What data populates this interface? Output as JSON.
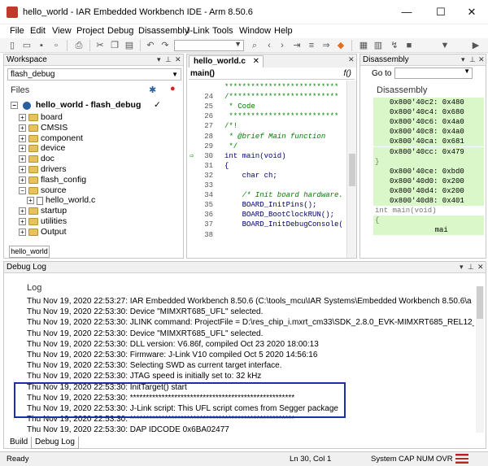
{
  "window": {
    "title": "hello_world - IAR Embedded Workbench IDE - Arm 8.50.6",
    "min_glyph": "—",
    "max_glyph": "☐",
    "close_glyph": "✕"
  },
  "menu": [
    "File",
    "Edit",
    "View",
    "Project",
    "Debug",
    "Disassembly",
    "J-Link",
    "Tools",
    "Window",
    "Help"
  ],
  "toolbar": {
    "icons": [
      "new-file-icon",
      "open-folder-icon",
      "save-icon",
      "save-all-icon",
      "print-icon",
      "cut-icon",
      "copy-icon",
      "paste-icon",
      "undo-icon",
      "redo-icon",
      "find-combo",
      "search-icon",
      "go-back-icon",
      "go-forward-icon",
      "next-statement-icon",
      "toggle-breakpoint-icon",
      "make-icon",
      "compile-icon",
      "build-icon",
      "stop-icon",
      "download-icon",
      "debug-icon"
    ],
    "find_value": ""
  },
  "workspace": {
    "panel_title": "Workspace",
    "config": "flash_debug",
    "files_label": "Files",
    "project": "hello_world - flash_debug",
    "project_check": "✓",
    "items": [
      {
        "label": "board",
        "type": "folder",
        "indent": 1
      },
      {
        "label": "CMSIS",
        "type": "folder",
        "indent": 1
      },
      {
        "label": "component",
        "type": "folder",
        "indent": 1
      },
      {
        "label": "device",
        "type": "folder",
        "indent": 1
      },
      {
        "label": "doc",
        "type": "folder",
        "indent": 1
      },
      {
        "label": "drivers",
        "type": "folder",
        "indent": 1
      },
      {
        "label": "flash_config",
        "type": "folder",
        "indent": 1
      },
      {
        "label": "source",
        "type": "folder",
        "indent": 1
      },
      {
        "label": "hello_world.c",
        "type": "file",
        "indent": 2
      },
      {
        "label": "startup",
        "type": "folder",
        "indent": 1
      },
      {
        "label": "utilities",
        "type": "folder",
        "indent": 1
      },
      {
        "label": "Output",
        "type": "folder",
        "indent": 1
      }
    ],
    "tab": "hello_world"
  },
  "editor": {
    "tab": "hello_world.c",
    "function": "main()",
    "func_icon": "f()",
    "current_line": "30",
    "lines": [
      {
        "n": "",
        "text": "**************************",
        "cls": "c-comment"
      },
      {
        "n": "24",
        "text": "/*************************",
        "cls": "c-comment"
      },
      {
        "n": "25",
        "text": " * Code",
        "cls": "c-comment"
      },
      {
        "n": "26",
        "text": " *************************",
        "cls": "c-comment"
      },
      {
        "n": "27",
        "text": "/*!",
        "cls": "c-comment"
      },
      {
        "n": "28",
        "text": " * @brief Main function",
        "cls": "c-italic"
      },
      {
        "n": "29",
        "text": " */",
        "cls": "c-comment"
      },
      {
        "n": "30",
        "text": "int main(void)",
        "cls": "c-kw"
      },
      {
        "n": "31",
        "text": "{",
        "cls": "c-norm"
      },
      {
        "n": "32",
        "text": "    char ch;",
        "cls": "c-norm"
      },
      {
        "n": "33",
        "text": "",
        "cls": "c-norm"
      },
      {
        "n": "34",
        "text": "    /* Init board hardware.",
        "cls": "c-italic"
      },
      {
        "n": "35",
        "text": "    BOARD_InitPins();",
        "cls": "c-norm"
      },
      {
        "n": "36",
        "text": "    BOARD_BootClockRUN();",
        "cls": "c-norm"
      },
      {
        "n": "37",
        "text": "    BOARD_InitDebugConsole(",
        "cls": "c-norm"
      },
      {
        "n": "38",
        "text": "",
        "cls": "c-norm"
      }
    ]
  },
  "disassembly": {
    "panel_title": "Disassembly",
    "goto_label": "Go to",
    "goto_value": "",
    "title": "Disassembly",
    "rows": [
      {
        "text": "0x800'40c2: 0x480",
        "green": true
      },
      {
        "text": "0x800'40c4: 0x680",
        "green": true
      },
      {
        "text": "0x800'40c6: 0x4a0",
        "green": true
      },
      {
        "text": "0x800'40c8: 0x4a0",
        "green": true
      },
      {
        "text": "0x800'40ca: 0x681",
        "green": true
      },
      {
        "text": "0x800'40cc: 0x479",
        "green": true
      },
      {
        "text": "}",
        "green": true
      },
      {
        "text": "0x800'40ce: 0xbd0",
        "green": true
      },
      {
        "text": "0x800'40d0: 0x200",
        "green": true
      },
      {
        "text": "0x800'40d4: 0x200",
        "green": true
      },
      {
        "text": "0x800'40d8: 0x401",
        "green": true
      },
      {
        "text": "int main(void)",
        "green": false
      },
      {
        "text": "{",
        "green": true
      },
      {
        "text": "              mai",
        "green": true
      }
    ]
  },
  "debug_log": {
    "panel_title": "Debug Log",
    "header": "Log",
    "lines": [
      "Thu Nov 19, 2020 22:53:27: IAR Embedded Workbench 8.50.6 (C:\\tools_mcu\\IAR Systems\\Embedded Workbench 8.50.6\\a",
      "Thu Nov 19, 2020 22:53:30: Device \"MIMXRT685_UFL\" selected.",
      "Thu Nov 19, 2020 22:53:30: JLINK command: ProjectFile = D:\\res_chip_i.mxrt_cm33\\SDK_2.8.0_EVK-MIMXRT685_REL12_F",
      "Thu Nov 19, 2020 22:53:30: Device \"MIMXRT685_UFL\" selected.",
      "Thu Nov 19, 2020 22:53:30: DLL version: V6.86f, compiled Oct 23 2020 18:00:13",
      "Thu Nov 19, 2020 22:53:30: Firmware: J-Link V10 compiled Oct  5 2020 14:56:16",
      "Thu Nov 19, 2020 22:53:30: Selecting SWD as current target interface.",
      "Thu Nov 19, 2020 22:53:30: JTAG speed is initially set to: 32 kHz",
      "Thu Nov 19, 2020 22:53:30: InitTarget() start",
      "Thu Nov 19, 2020 22:53:30: ****************************************************",
      "Thu Nov 19, 2020 22:53:30: J-Link script: This UFL script comes from Segger package",
      "Thu Nov 19, 2020 22:53:30: ****************************************************",
      "Thu Nov 19, 2020 22:53:30: DAP IDCODE 0x6BA02477"
    ]
  },
  "bottom_tabs": [
    "Build",
    "Debug Log"
  ],
  "status": {
    "ready": "Ready",
    "position": "Ln 30, Col 1",
    "encoding": "System",
    "cap": "CAP",
    "num": "NUM",
    "ovr": "OVR"
  },
  "colors": {
    "highlight_box": "#1a2fa8",
    "disasm_green": "#d9f7c8",
    "comment": "#008000"
  }
}
